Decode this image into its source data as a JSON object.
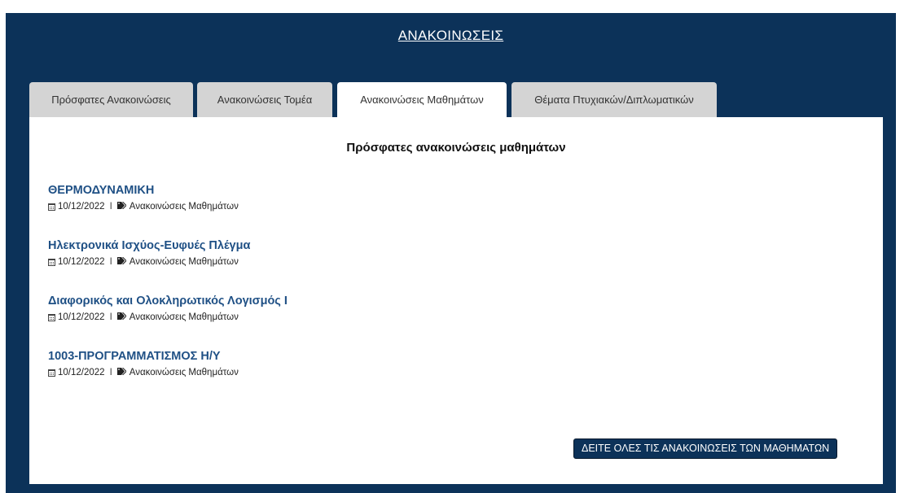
{
  "header": {
    "title": "ΑΝΑΚΟΙΝΩΣΕΙΣ"
  },
  "tabs": [
    {
      "label": "Πρόσφατες Ανακοινώσεις",
      "active": false
    },
    {
      "label": "Ανακοινώσεις Τομέα",
      "active": false
    },
    {
      "label": "Ανακοινώσεις Μαθημάτων",
      "active": true
    },
    {
      "label": "Θέματα Πτυχιακών/Διπλωματικών",
      "active": false
    }
  ],
  "content": {
    "heading": "Πρόσφατες ανακοινώσεις μαθημάτων",
    "items": [
      {
        "title": "ΘΕΡΜΟΔΥΝΑΜΙΚΗ",
        "date": "10/12/2022",
        "separator": "I",
        "category": "Ανακοινώσεις Μαθημάτων"
      },
      {
        "title": "Ηλεκτρονικά Ισχύος-Ευφυές Πλέγμα",
        "date": "10/12/2022",
        "separator": "I",
        "category": "Ανακοινώσεις Μαθημάτων"
      },
      {
        "title": "Διαφορικός και Ολοκληρωτικός Λογισμός Ι",
        "date": "10/12/2022",
        "separator": "I",
        "category": "Ανακοινώσεις Μαθημάτων"
      },
      {
        "title": "1003-ΠΡΟΓΡΑΜΜΑΤΙΣΜΟΣ Η/Υ",
        "date": "10/12/2022",
        "separator": "I",
        "category": "Ανακοινώσεις Μαθημάτων"
      }
    ],
    "all_button_label": "ΔΕΙΤΕ ΟΛΕΣ ΤΙΣ ΑΝΑΚΟΙΝΩΣΕΙΣ ΤΩΝ ΜΑΘΗΜΑΤΩΝ"
  },
  "icons": {
    "date": "calendar-icon",
    "category": "tag-icon"
  },
  "colors": {
    "panel_background": "#0c3259",
    "tab_inactive": "#d4d4d4",
    "tab_active": "#ffffff",
    "link": "#1f5085",
    "button_background": "#0c3259"
  }
}
